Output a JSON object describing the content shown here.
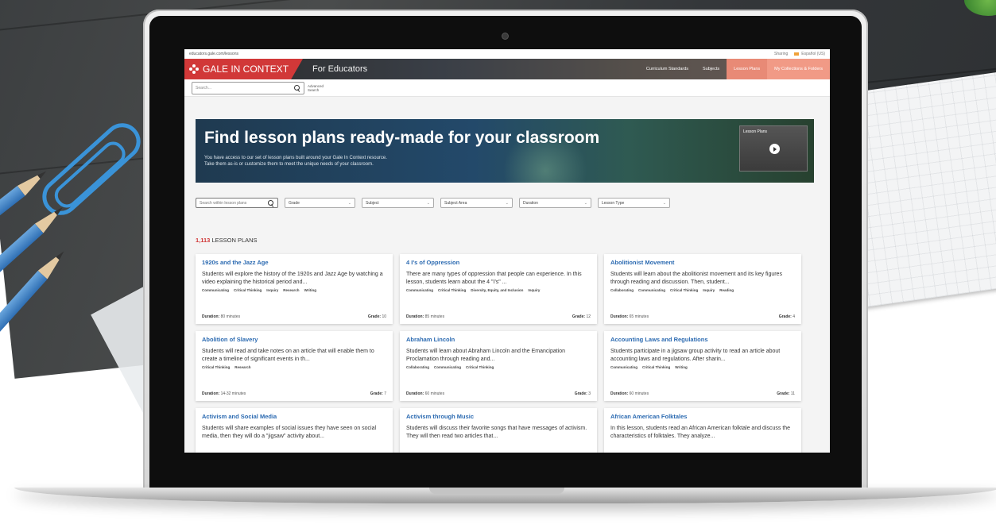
{
  "browser": {
    "url": "educators.gale.com/lessons"
  },
  "utility_links": [
    "Sharing",
    "Español (US)"
  ],
  "header": {
    "brand": "GALE IN CONTEXT",
    "sub": "For Educators",
    "nav": [
      "Curriculum Standards",
      "Subjects",
      "Lesson Plans",
      "My Collections & Folders"
    ]
  },
  "search": {
    "placeholder": "Search...",
    "advanced": "Advanced Search"
  },
  "hero": {
    "title": "Find lesson plans ready-made for your classroom",
    "line1": "You have access to our set of lesson plans built around your Gale In Context resource.",
    "line2": "Take them as-is or customize them to meet the unique needs of your classroom.",
    "video_label": "Lesson Plans"
  },
  "filters": {
    "search_placeholder": "Search within lesson plans",
    "options": [
      "Grade",
      "Subject",
      "Subject Area",
      "Duration",
      "Lesson Type"
    ]
  },
  "results": {
    "count": "1,113",
    "label": "LESSON PLANS"
  },
  "labels": {
    "duration": "Duration:",
    "grade": "Grade:"
  },
  "cards": [
    {
      "title": "1920s and the Jazz Age",
      "desc": "Students will explore the history of the 1920s and Jazz Age by watching a video explaining the historical period and...",
      "tags": [
        "Communicating",
        "Critical Thinking",
        "Inquiry",
        "Research",
        "Writing"
      ],
      "duration": "80 minutes",
      "grade": "10"
    },
    {
      "title": "4 I's of Oppression",
      "desc": "There are many types of oppression that people can experience. In this lesson, students learn about the 4 \"I's\" ...",
      "tags": [
        "Communicating",
        "Critical Thinking",
        "Diversity, Equity, and Inclusion",
        "Inquiry"
      ],
      "duration": "85 minutes",
      "grade": "12"
    },
    {
      "title": "Abolitionist Movement",
      "desc": "Students will learn about the abolitionist movement and its key figures through reading and discussion. Then, student...",
      "tags": [
        "Collaborating",
        "Communicating",
        "Critical Thinking",
        "Inquiry",
        "Reading"
      ],
      "duration": "65 minutes",
      "grade": "4"
    },
    {
      "title": "Abolition of Slavery",
      "desc": "Students will read and take notes on an article that will enable them to create a timeline of significant events in th...",
      "tags": [
        "Critical Thinking",
        "Research"
      ],
      "duration": "14-32 minutes",
      "grade": "7"
    },
    {
      "title": "Abraham Lincoln",
      "desc": "Students will learn about Abraham Lincoln and the Emancipation Proclamation through reading and...",
      "tags": [
        "Collaborating",
        "Communicating",
        "Critical Thinking"
      ],
      "duration": "60 minutes",
      "grade": "3"
    },
    {
      "title": "Accounting Laws and Regulations",
      "desc": "Students participate in a jigsaw group activity to read an article about accounting laws and regulations. After sharin...",
      "tags": [
        "Communicating",
        "Critical Thinking",
        "Writing"
      ],
      "duration": "60 minutes",
      "grade": "11"
    },
    {
      "title": "Activism and Social Media",
      "desc": "Students will share examples of social issues they have seen on social media, then they will do a \"jigsaw\" activity about...",
      "tags": [],
      "duration": "",
      "grade": ""
    },
    {
      "title": "Activism through Music",
      "desc": "Students will discuss their favorite songs that have messages of activism. They will then read two articles that...",
      "tags": [],
      "duration": "",
      "grade": ""
    },
    {
      "title": "African American Folktales",
      "desc": "In this lesson, students read an African American folktale and discuss the characteristics of folktales. They analyze...",
      "tags": [],
      "duration": "",
      "grade": ""
    }
  ]
}
